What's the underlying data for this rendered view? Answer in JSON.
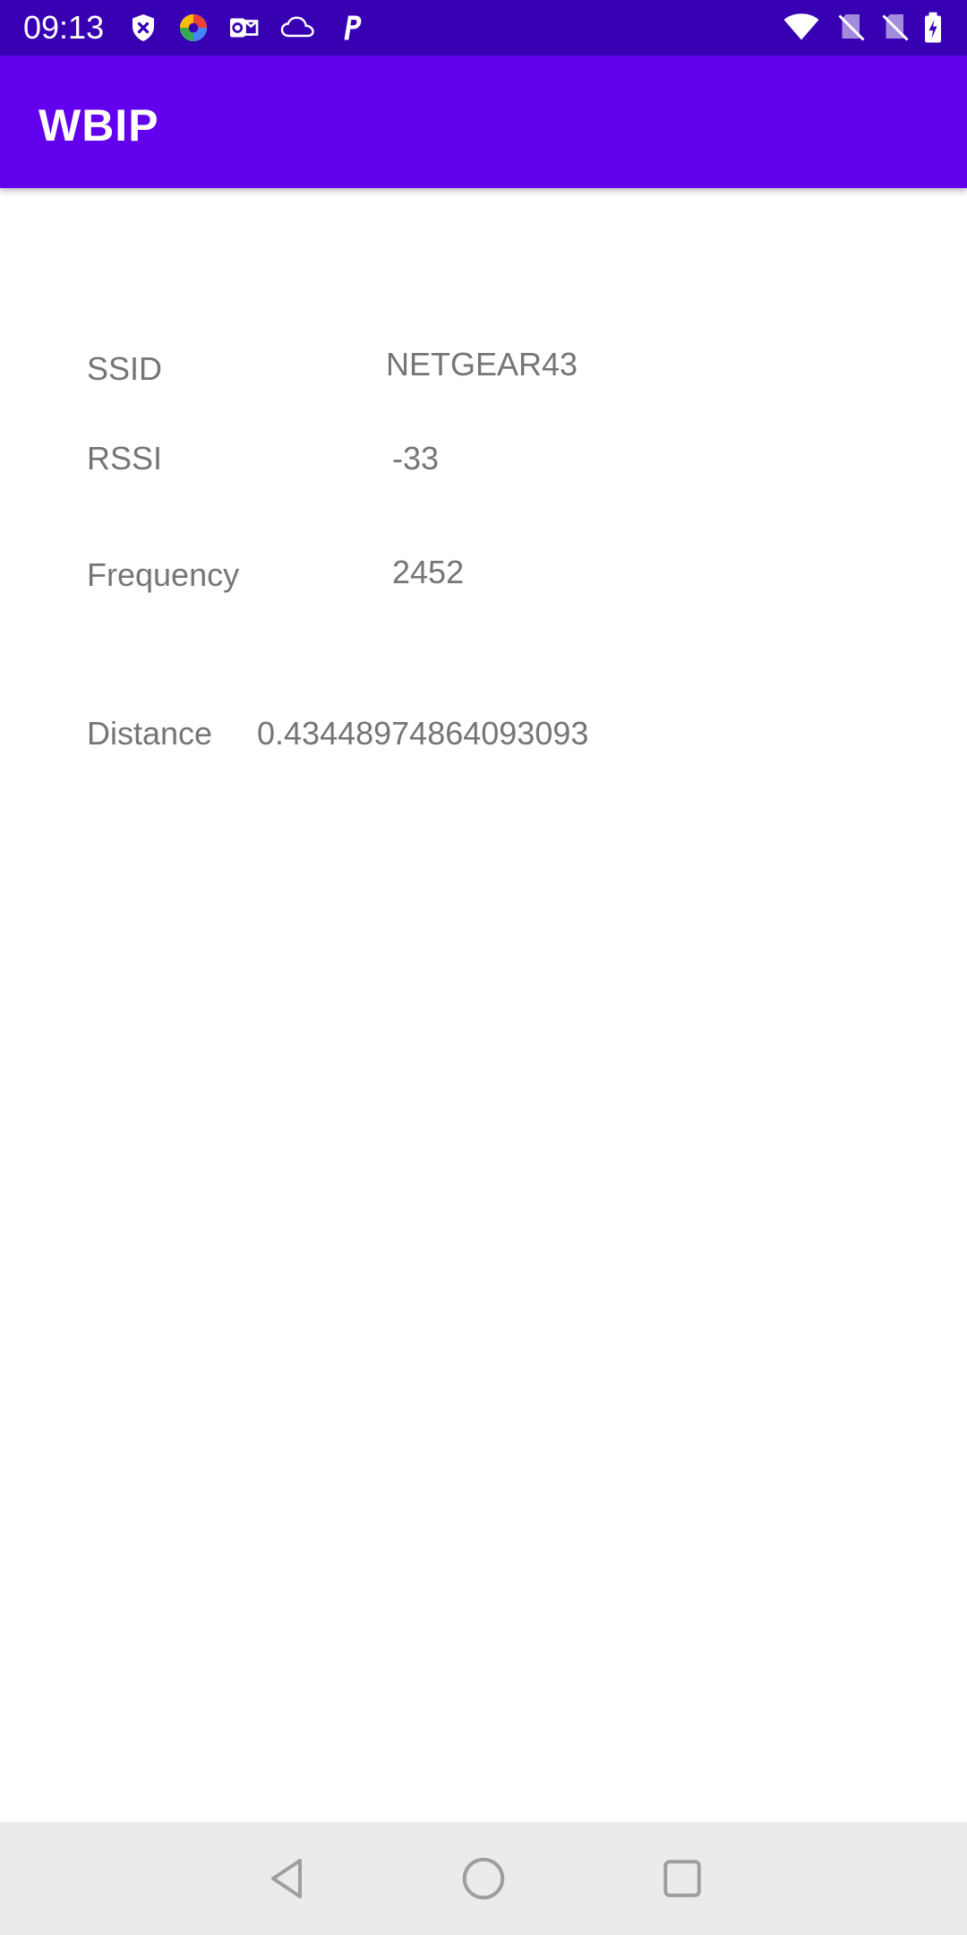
{
  "status_bar": {
    "time": "09:13",
    "left_icons": [
      "shield-icon",
      "photos-icon",
      "outlook-icon",
      "cloud-icon",
      "paypal-icon"
    ],
    "right_icons": [
      "wifi-icon",
      "no-sim-icon",
      "no-sim-icon",
      "battery-charging-icon"
    ]
  },
  "app_bar": {
    "title": "WBIP",
    "color": "#6200ee"
  },
  "info": {
    "ssid_label": "SSID",
    "ssid_value": "NETGEAR43",
    "rssi_label": "RSSI",
    "rssi_value": "-33",
    "frequency_label": "Frequency",
    "frequency_value": "2452",
    "distance_label": "Distance",
    "distance_value": "0.43448974864093093"
  },
  "nav_bar": {
    "buttons": [
      "back-icon",
      "home-icon",
      "recents-icon"
    ]
  },
  "colors": {
    "status_bar": "#3700b3",
    "app_bar": "#6200ee",
    "text_secondary": "#757575",
    "nav_bar": "#ebebeb"
  }
}
